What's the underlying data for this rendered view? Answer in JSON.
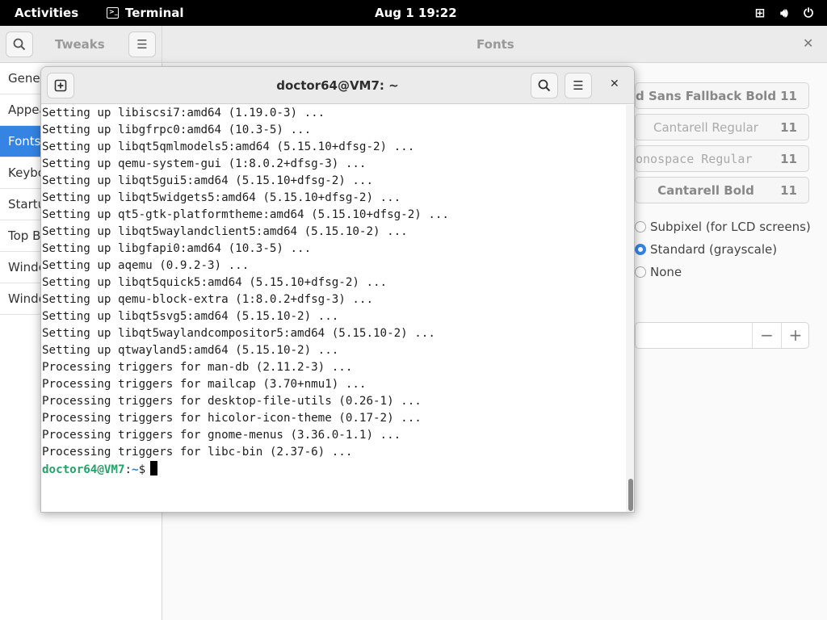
{
  "topbar": {
    "activities": "Activities",
    "app_name": "Terminal",
    "clock": "Aug 1  19:22",
    "tray_icons": [
      "network-icon",
      "volume-icon",
      "power-icon"
    ]
  },
  "tweaks": {
    "title": "Tweaks",
    "page_title": "Fonts",
    "sidebar": [
      {
        "label": "General"
      },
      {
        "label": "Appearance"
      },
      {
        "label": "Fonts",
        "active": true
      },
      {
        "label": "Keyboard & Mouse"
      },
      {
        "label": "Startup Applications"
      },
      {
        "label": "Top Bar"
      },
      {
        "label": "Window Titlebars"
      },
      {
        "label": "Windows"
      }
    ],
    "fonts": [
      {
        "name": "d Sans Fallback Bold",
        "size": "11"
      },
      {
        "name": "Cantarell Regular",
        "size": "11"
      },
      {
        "name": "onospace Regular",
        "size": "11"
      },
      {
        "name": "Cantarell Bold",
        "size": "11"
      }
    ],
    "antialiasing": [
      {
        "label": "Subpixel (for LCD screens)",
        "selected": false
      },
      {
        "label": "Standard (grayscale)",
        "selected": true
      },
      {
        "label": "None",
        "selected": false
      }
    ],
    "scale_minus": "−",
    "scale_plus": "+"
  },
  "terminal": {
    "title": "doctor64@VM7: ~",
    "lines": [
      "Setting up libiscsi7:amd64 (1.19.0-3) ...",
      "Setting up libgfrpc0:amd64 (10.3-5) ...",
      "Setting up libqt5qmlmodels5:amd64 (5.15.10+dfsg-2) ...",
      "Setting up qemu-system-gui (1:8.0.2+dfsg-3) ...",
      "Setting up libqt5gui5:amd64 (5.15.10+dfsg-2) ...",
      "Setting up libqt5widgets5:amd64 (5.15.10+dfsg-2) ...",
      "Setting up qt5-gtk-platformtheme:amd64 (5.15.10+dfsg-2) ...",
      "Setting up libqt5waylandclient5:amd64 (5.15.10-2) ...",
      "Setting up libgfapi0:amd64 (10.3-5) ...",
      "Setting up aqemu (0.9.2-3) ...",
      "Setting up libqt5quick5:amd64 (5.15.10+dfsg-2) ...",
      "Setting up qemu-block-extra (1:8.0.2+dfsg-3) ...",
      "Setting up libqt5svg5:amd64 (5.15.10-2) ...",
      "Setting up libqt5waylandcompositor5:amd64 (5.15.10-2) ...",
      "Setting up qtwayland5:amd64 (5.15.10-2) ...",
      "Processing triggers for man-db (2.11.2-3) ...",
      "Processing triggers for mailcap (3.70+nmu1) ...",
      "Processing triggers for desktop-file-utils (0.26-1) ...",
      "Processing triggers for hicolor-icon-theme (0.17-2) ...",
      "Processing triggers for gnome-menus (3.36.0-1.1) ...",
      "Processing triggers for libc-bin (2.37-6) ..."
    ],
    "prompt_user": "doctor64@VM7",
    "prompt_sep": ":",
    "prompt_path": "~",
    "prompt_symbol": "$"
  }
}
